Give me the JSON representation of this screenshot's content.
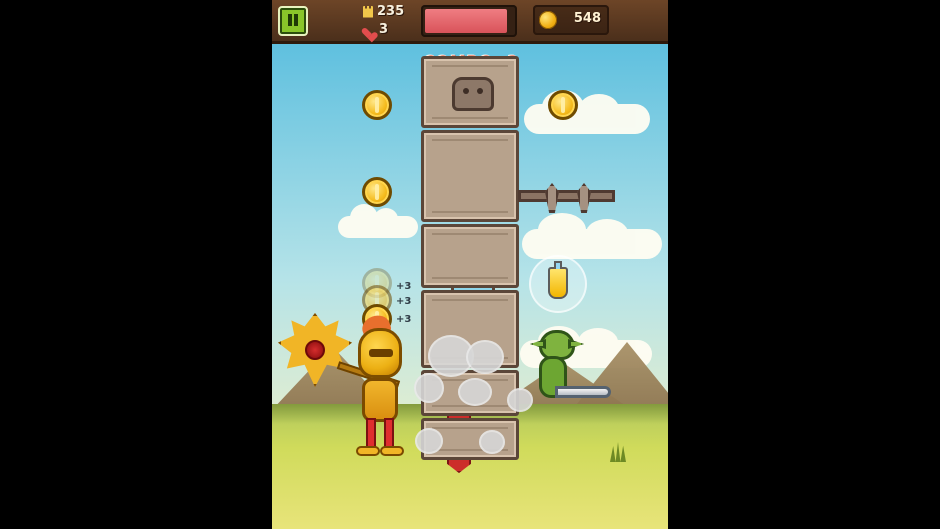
{
  "hud": {
    "pause_icon": "pause-icon",
    "tower_height_icon": "tower-icon",
    "tower_height": "235",
    "lives_icon": "heart-icon",
    "lives": "3",
    "health_fill": 0.93,
    "coin_icon": "coin-icon",
    "coins": "548"
  },
  "play_area": {
    "combo_text": "COMBO×3",
    "coin_bonus_1": "+3",
    "coin_bonus_2": "+3",
    "coin_bonus_3": "+3",
    "colors": {
      "sky_top": "#5fc0df",
      "grass": "#c9d65b",
      "combo": "#e43e25",
      "health": "#d9535a"
    }
  }
}
